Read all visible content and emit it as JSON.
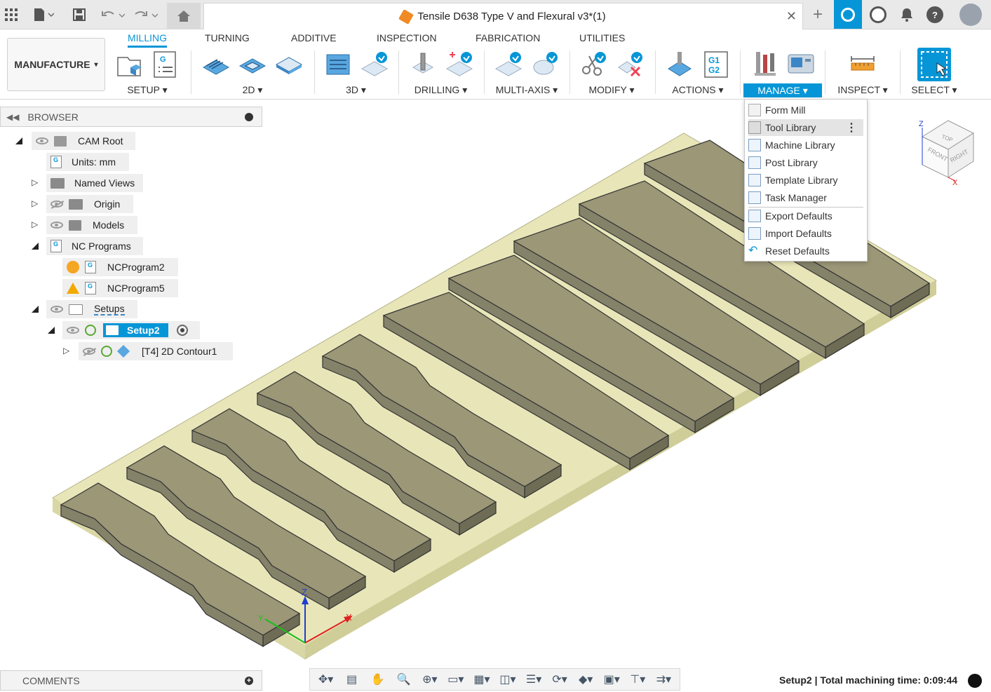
{
  "window": {
    "title": "Tensile D638 Type V and Flexural v3*(1)"
  },
  "ribbon": {
    "workspace": "MANUFACTURE",
    "tabs": [
      "MILLING",
      "TURNING",
      "ADDITIVE",
      "INSPECTION",
      "FABRICATION",
      "UTILITIES"
    ],
    "active_tab": "MILLING",
    "groups": {
      "setup": "SETUP ▾",
      "two_d": "2D ▾",
      "three_d": "3D ▾",
      "drilling": "DRILLING ▾",
      "multi_axis": "MULTI-AXIS ▾",
      "modify": "MODIFY ▾",
      "actions": "ACTIONS ▾",
      "manage": "MANAGE ▾",
      "inspect": "INSPECT ▾",
      "select": "SELECT ▾"
    },
    "accent_color": "#0696d7"
  },
  "manage_menu": {
    "items": [
      "Form Mill",
      "Tool Library",
      "Machine Library",
      "Post Library",
      "Template Library",
      "Task Manager",
      "Export Defaults",
      "Import Defaults",
      "Reset Defaults"
    ],
    "highlighted": "Tool Library"
  },
  "browser": {
    "title": "BROWSER",
    "tree": {
      "cam_root": "CAM Root",
      "units": "Units: mm",
      "named_views": "Named Views",
      "origin": "Origin",
      "models": "Models",
      "nc_programs": "NC Programs",
      "ncprogram2": "NCProgram2",
      "ncprogram5": "NCProgram5",
      "setups": "Setups",
      "setup2": "Setup2",
      "contour": "[T4] 2D Contour1"
    }
  },
  "viewcube": {
    "top": "TOP",
    "front": "FRONT",
    "right": "RIGHT",
    "z": "Z",
    "x": "X"
  },
  "triad": {
    "z": "Z",
    "x": "X",
    "y": "Y"
  },
  "comments": {
    "title": "COMMENTS"
  },
  "status": {
    "text": "Setup2 | Total machining time: 0:09:44"
  },
  "colors": {
    "stock": "#e8e6b8",
    "part_top": "#9b9777",
    "part_side": "#6e6c55"
  }
}
